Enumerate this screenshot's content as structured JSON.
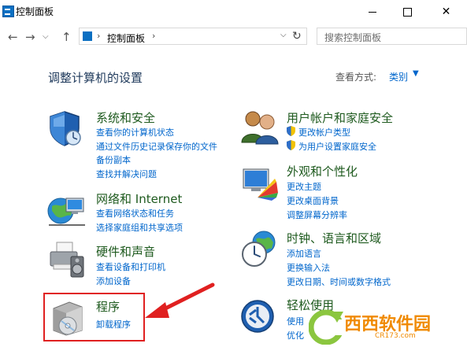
{
  "window": {
    "title": "控制面板"
  },
  "nav": {
    "back_icon": "left-arrow-icon",
    "forward_icon": "right-arrow-icon",
    "up_icon": "up-arrow-icon",
    "address_text": "控制面板",
    "search_placeholder": "搜索控制面板"
  },
  "main": {
    "heading": "调整计算机的设置",
    "view_by_label": "查看方式:",
    "view_by_value": "类别"
  },
  "categories_left": [
    {
      "title": "系统和安全",
      "icon": "shield-icon",
      "links": [
        "查看你的计算机状态",
        "通过文件历史记录保存你的文件",
        "备份副本",
        "查找并解决问题"
      ]
    },
    {
      "title": "网络和 Internet",
      "icon": "network-globe-icon",
      "links": [
        "查看网络状态和任务",
        "选择家庭组和共享选项"
      ]
    },
    {
      "title": "硬件和声音",
      "icon": "printer-speaker-icon",
      "links": [
        "查看设备和打印机",
        "添加设备"
      ]
    },
    {
      "title": "程序",
      "icon": "programs-box-icon",
      "links": [
        "卸载程序"
      ]
    }
  ],
  "categories_right": [
    {
      "title": "用户帐户和家庭安全",
      "icon": "users-icon",
      "links": [
        "更改帐户类型",
        "为用户设置家庭安全"
      ]
    },
    {
      "title": "外观和个性化",
      "icon": "monitor-palette-icon",
      "links": [
        "更改主题",
        "更改桌面背景",
        "调整屏幕分辨率"
      ]
    },
    {
      "title": "时钟、语言和区域",
      "icon": "clock-globe-icon",
      "links": [
        "添加语言",
        "更换输入法",
        "更改日期、时间或数字格式"
      ]
    },
    {
      "title": "轻松使用",
      "icon": "ease-of-access-icon",
      "links": [
        "使用",
        "优化"
      ]
    }
  ],
  "watermark": {
    "text": "西西软件园",
    "sub": "CR173.com"
  },
  "colors": {
    "link": "#0066cc",
    "category_title": "#1e5a1e",
    "heading": "#1e395b",
    "highlight": "#e02020"
  }
}
